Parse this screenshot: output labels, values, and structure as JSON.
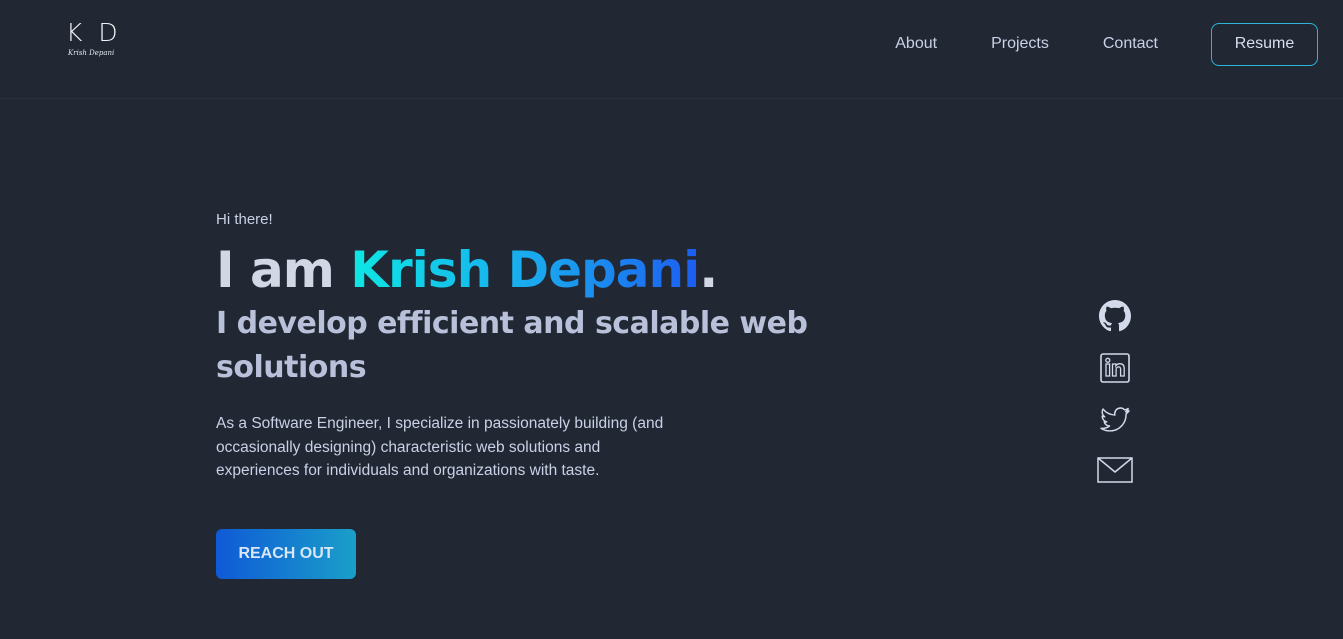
{
  "header": {
    "logo": {
      "mark": "K D",
      "subtitle": "Krish Depani"
    },
    "nav": [
      {
        "label": "About"
      },
      {
        "label": "Projects"
      },
      {
        "label": "Contact"
      }
    ],
    "resume_label": "Resume"
  },
  "hero": {
    "greeting": "Hi there!",
    "headline_prefix": "I am ",
    "name": "Krish Depani",
    "headline_suffix": ".",
    "tagline": "I develop efficient and scalable web solutions",
    "bio": "As a Software Engineer, I specialize in passionately building (and occasionally designing) characteristic web solutions and experiences for individuals and organizations with taste.",
    "cta_label": "REACH OUT"
  },
  "socials": [
    {
      "icon": "github-icon"
    },
    {
      "icon": "linkedin-icon"
    },
    {
      "icon": "twitter-icon"
    },
    {
      "icon": "mail-icon"
    }
  ],
  "colors": {
    "background": "#212733",
    "accent_start": "#0ee7e4",
    "accent_end": "#1c5df0",
    "text": "#c9d1e6"
  }
}
